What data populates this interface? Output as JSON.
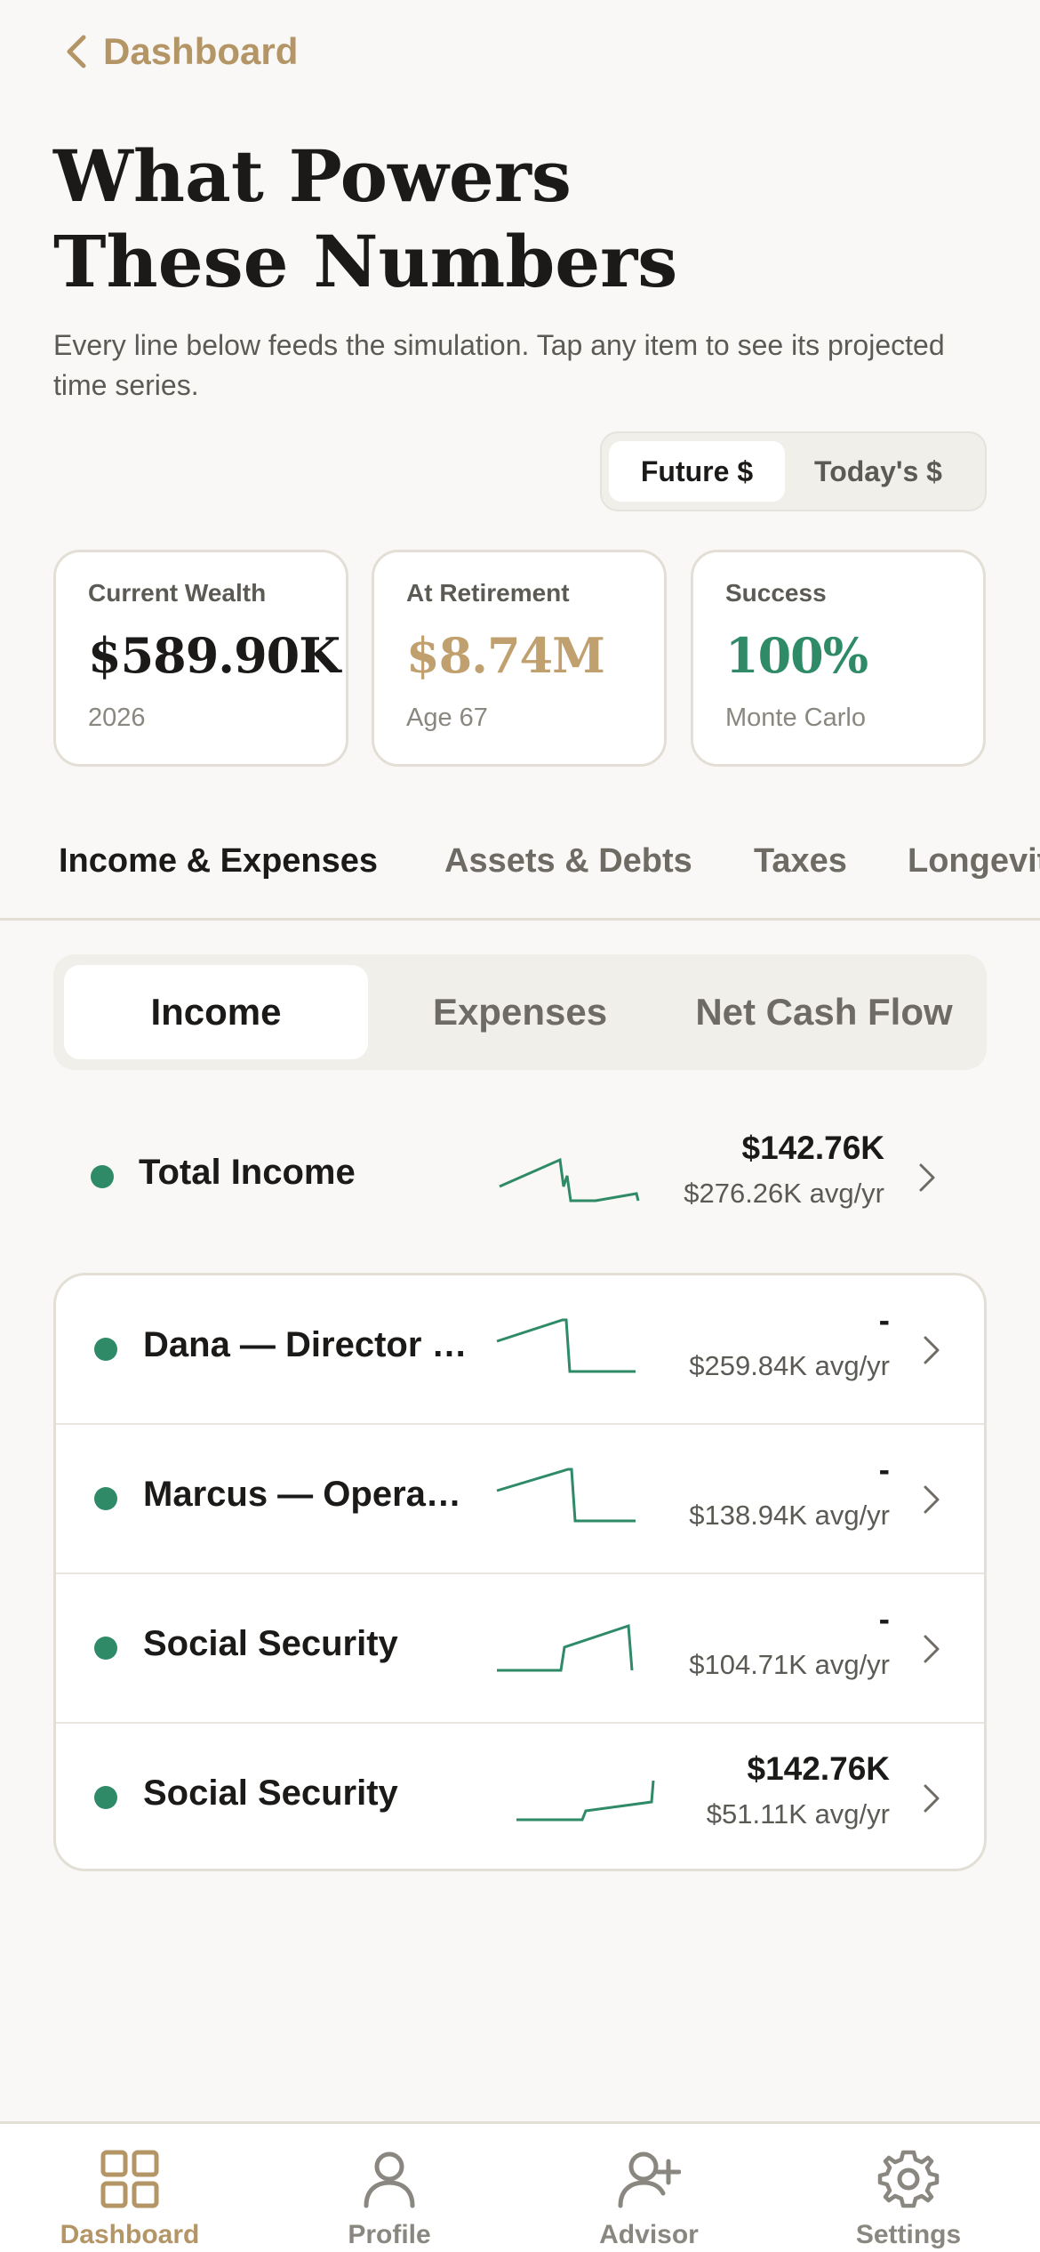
{
  "header": {
    "back_label": "Dashboard",
    "title_line1": "What Powers",
    "title_line2": "These Numbers",
    "subtitle": "Every line below feeds the simulation. Tap any item to see its projected time series."
  },
  "dollar_toggle": {
    "options": [
      "Future $",
      "Today's $"
    ],
    "selected": "Future $"
  },
  "stats": [
    {
      "label": "Current Wealth",
      "value": "$589.90K",
      "sub": "2026",
      "color": "#1b1a18"
    },
    {
      "label": "At Retirement",
      "value": "$8.74M",
      "sub": "Age 67",
      "color": "#c0a06e"
    },
    {
      "label": "Success",
      "value": "100%",
      "sub": "Monte Carlo",
      "color": "#2e8a67"
    }
  ],
  "tabs": [
    "Income & Expenses",
    "Assets & Debts",
    "Taxes",
    "Longevity"
  ],
  "active_tab": "Income & Expenses",
  "segments": [
    "Income",
    "Expenses",
    "Net Cash Flow"
  ],
  "active_segment": "Income",
  "total_row": {
    "label": "Total Income",
    "value": "$142.76K",
    "avg": "$276.26K avg/yr"
  },
  "items": [
    {
      "label": "Dana — Director of Engineering",
      "value": "-",
      "avg": "$259.84K avg/yr"
    },
    {
      "label": "Marcus — Operations Manager",
      "value": "-",
      "avg": "$138.94K avg/yr"
    },
    {
      "label": "Social Security",
      "value": "-",
      "avg": "$104.71K avg/yr"
    },
    {
      "label": "Social Security",
      "value": "$142.76K",
      "avg": "$51.11K avg/yr"
    }
  ],
  "nav": [
    {
      "label": "Dashboard",
      "icon": "grid-icon"
    },
    {
      "label": "Profile",
      "icon": "person-icon"
    },
    {
      "label": "Advisor",
      "icon": "add-person-icon"
    },
    {
      "label": "Settings",
      "icon": "gear-icon"
    }
  ],
  "colors": {
    "accent": "#b39566",
    "positive": "#2e8a67",
    "text": "#1b1a18"
  }
}
